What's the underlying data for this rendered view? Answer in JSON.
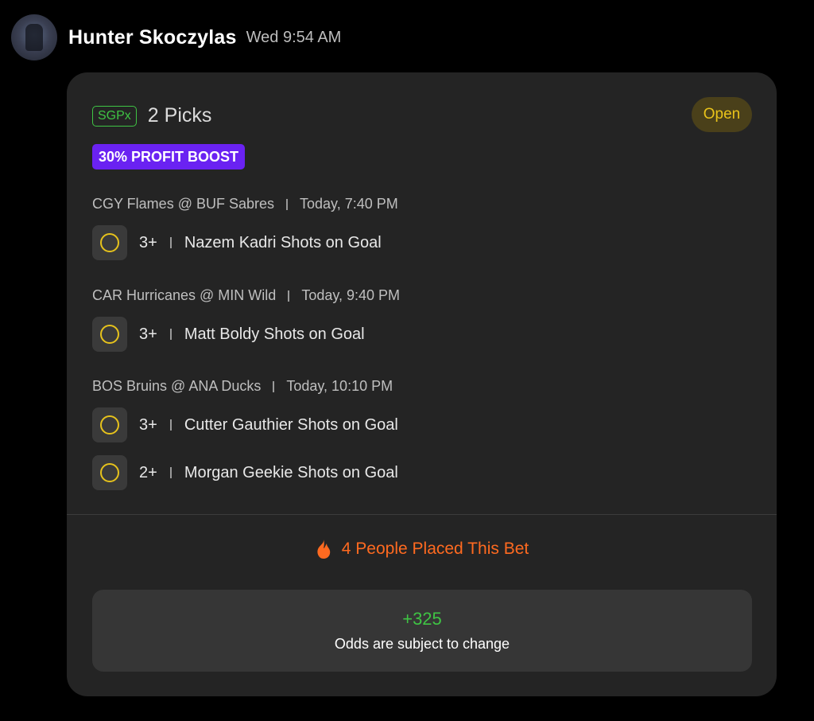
{
  "message": {
    "username": "Hunter Skoczylas",
    "timestamp": "Wed 9:54 AM"
  },
  "bet": {
    "type_badge": "SGPx",
    "picks_label": "2 Picks",
    "status": "Open",
    "boost_label": "30% PROFIT BOOST",
    "games": [
      {
        "matchup": "CGY Flames @ BUF Sabres",
        "time": "Today, 7:40 PM",
        "picks": [
          {
            "line": "3+",
            "market": "Nazem Kadri Shots on Goal"
          }
        ]
      },
      {
        "matchup": "CAR Hurricanes @ MIN Wild",
        "time": "Today, 9:40 PM",
        "picks": [
          {
            "line": "3+",
            "market": "Matt Boldy Shots on Goal"
          }
        ]
      },
      {
        "matchup": "BOS Bruins @ ANA Ducks",
        "time": "Today, 10:10 PM",
        "picks": [
          {
            "line": "3+",
            "market": "Cutter Gauthier Shots on Goal"
          },
          {
            "line": "2+",
            "market": "Morgan Geekie Shots on Goal"
          }
        ]
      }
    ],
    "social_proof": "4 People Placed This Bet",
    "social_icon": "fire-icon",
    "odds": "+325",
    "odds_note": "Odds are subject to change"
  },
  "colors": {
    "background": "#000000",
    "card": "#242424",
    "accent_green": "#3fc444",
    "boost_purple": "#6a22f2",
    "status_yellow": "#e6c21c",
    "fire_orange": "#ff6a20"
  }
}
